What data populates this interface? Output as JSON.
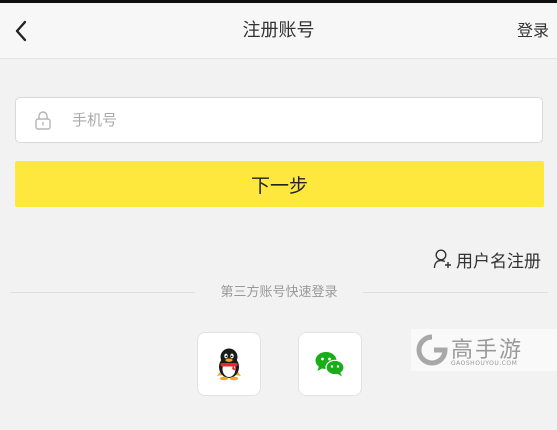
{
  "nav": {
    "title": "注册账号",
    "login_label": "登录",
    "back_icon": "chevron-left-icon"
  },
  "form": {
    "phone_placeholder": "手机号",
    "phone_value": "",
    "lock_icon": "lock-icon",
    "next_label": "下一步"
  },
  "username_register": {
    "label": "用户名注册",
    "icon": "user-add-icon"
  },
  "third_party": {
    "label": "第三方账号快速登录",
    "providers": [
      "qq-icon",
      "wechat-icon"
    ]
  },
  "watermark": {
    "text": "高手游",
    "url": "GAOSHOUYOU.COM"
  },
  "colors": {
    "accent": "#ffe83d",
    "wechat": "#1aad19"
  }
}
